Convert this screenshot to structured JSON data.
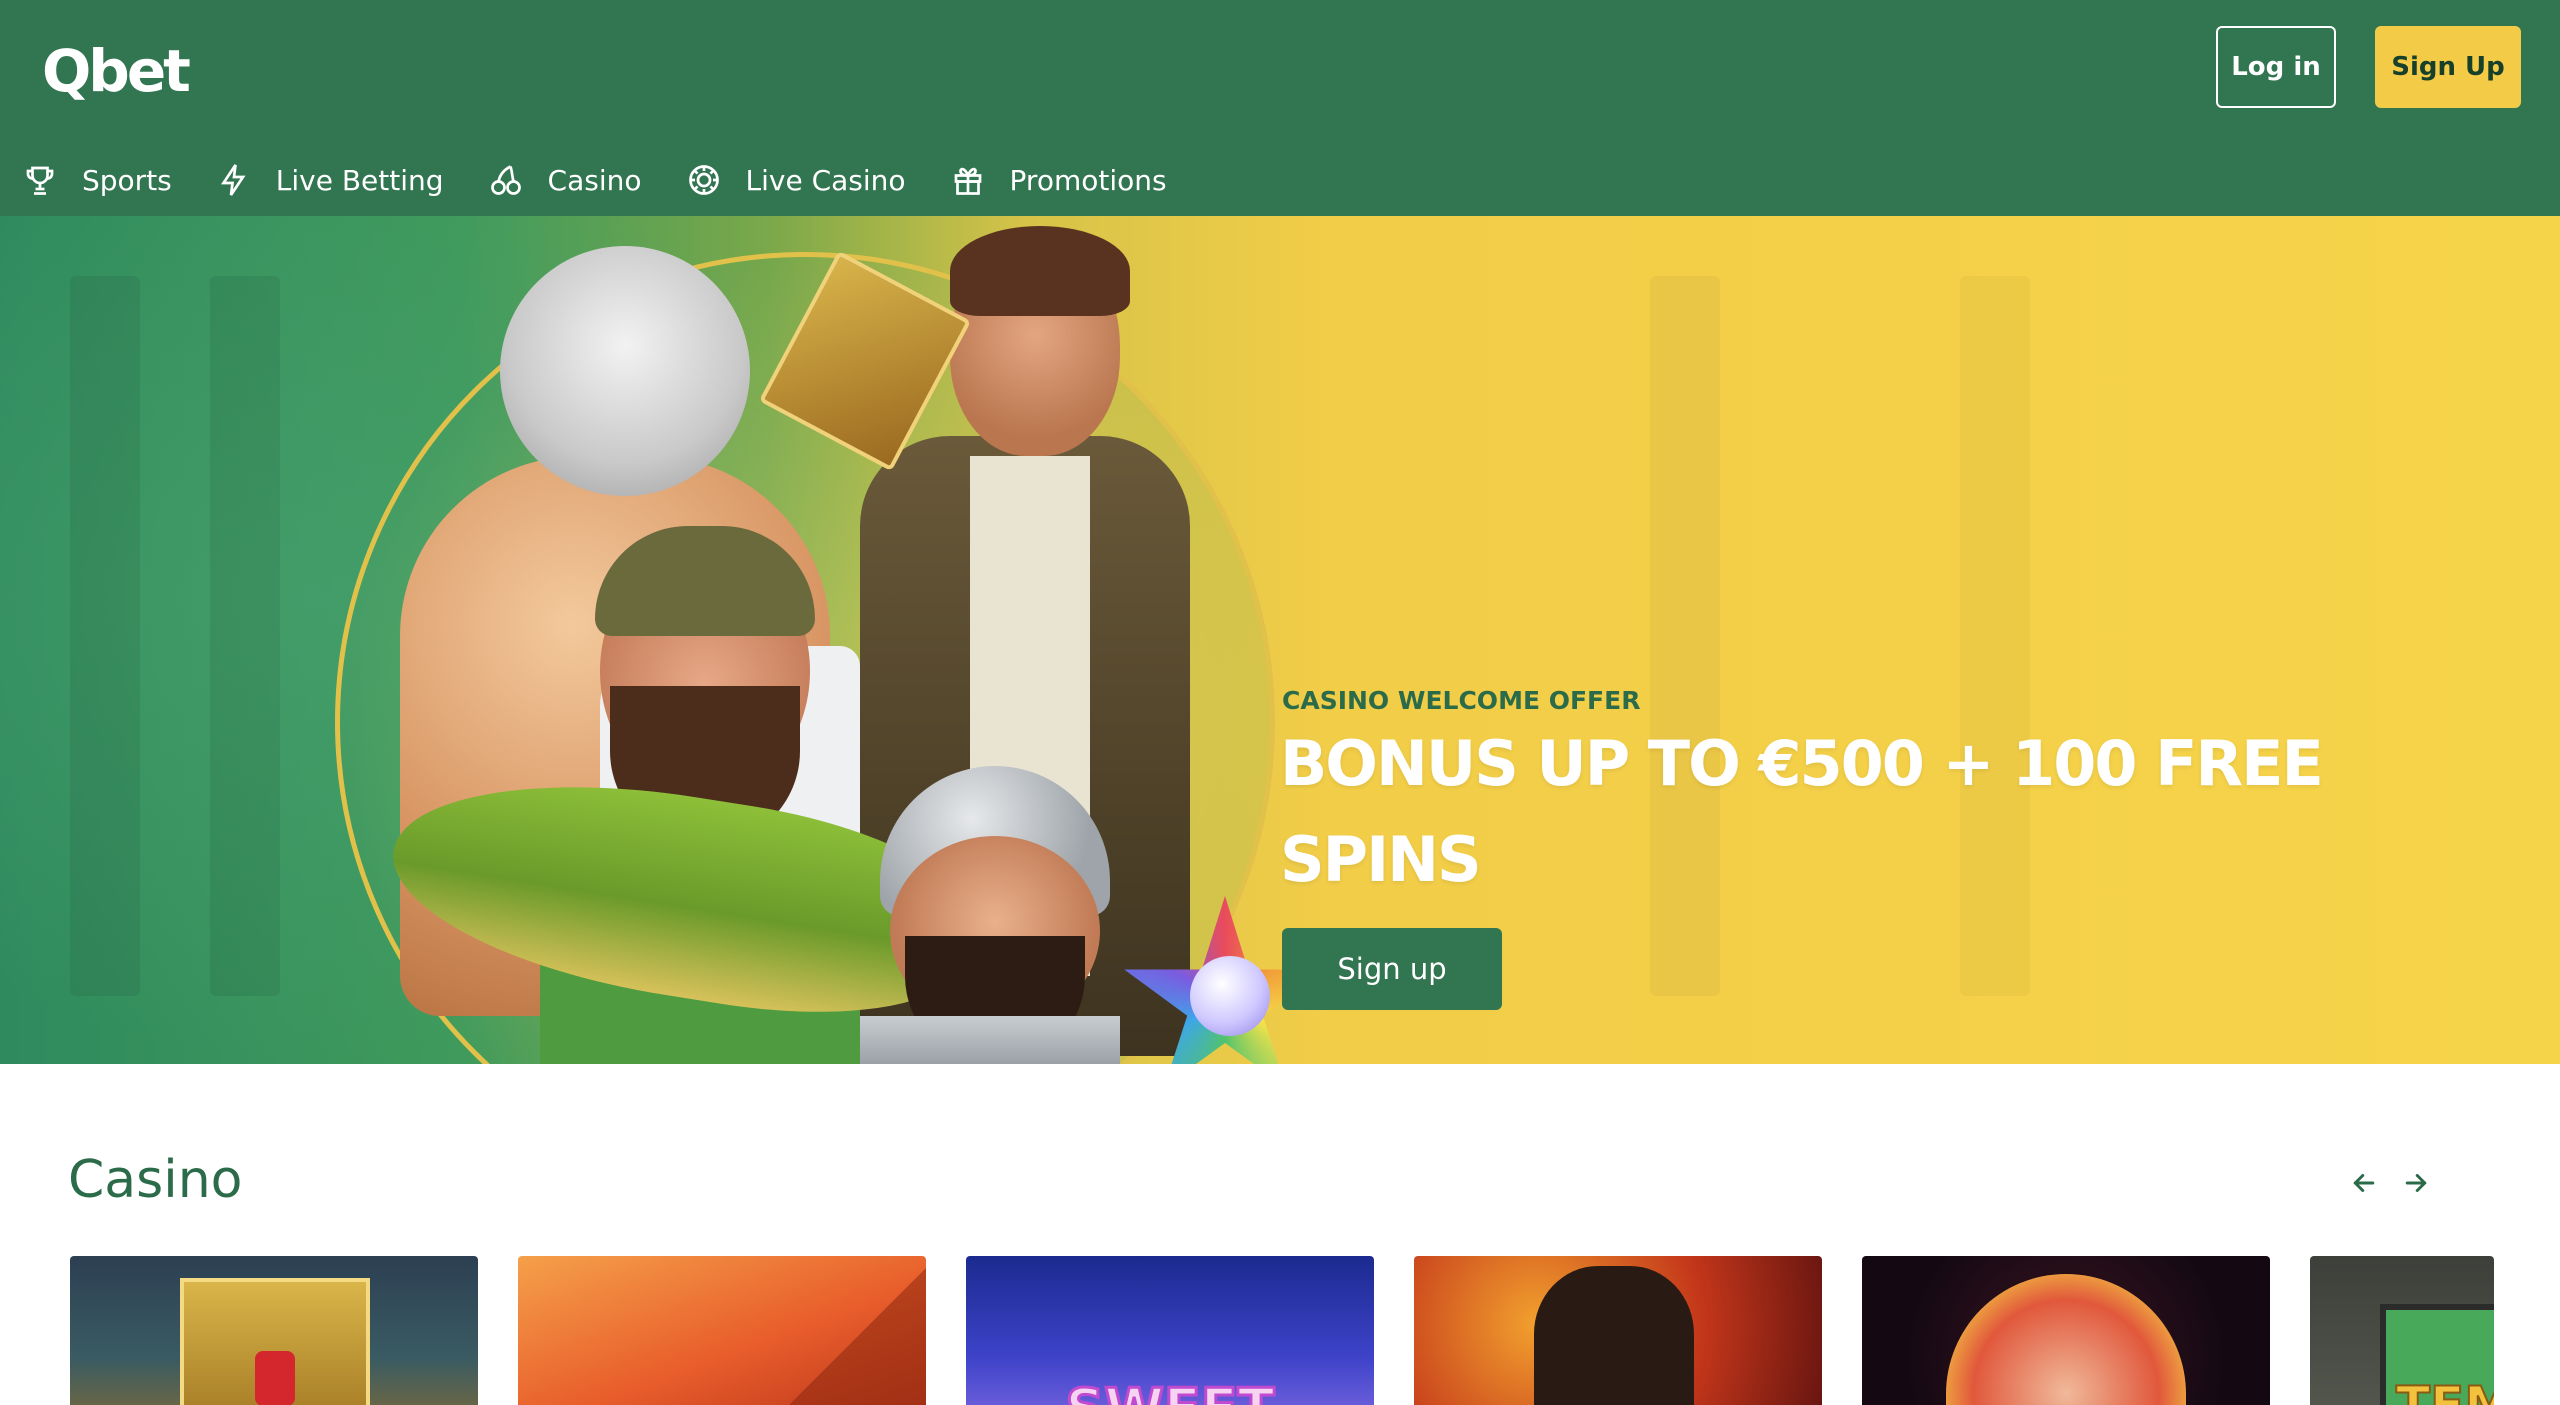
{
  "header": {
    "logo": "Qbet",
    "login_label": "Log in",
    "signup_label": "Sign Up"
  },
  "nav": {
    "items": [
      {
        "label": "Sports",
        "icon": "trophy-icon"
      },
      {
        "label": "Live Betting",
        "icon": "lightning-icon"
      },
      {
        "label": "Casino",
        "icon": "cherries-icon"
      },
      {
        "label": "Live Casino",
        "icon": "roulette-chip-icon"
      },
      {
        "label": "Promotions",
        "icon": "gift-icon"
      }
    ]
  },
  "hero": {
    "kicker": "CASINO WELCOME OFFER",
    "title": "BONUS UP TO €500 + 100 FREE SPINS",
    "button_label": "Sign up",
    "slides_total": 6,
    "active_slide": 2
  },
  "casino": {
    "title": "Casino",
    "prev_icon": "arrow-left-icon",
    "next_icon": "arrow-right-icon",
    "tiles": [
      {
        "label": ""
      },
      {
        "label": ""
      },
      {
        "label": "SWEET"
      },
      {
        "label": ""
      },
      {
        "label": ""
      },
      {
        "label": "TEM"
      }
    ]
  },
  "colors": {
    "brand_green": "#317551",
    "accent_yellow": "#f4cb47",
    "hero_yellow": "#f6d449",
    "heading_green": "#2b6b49"
  }
}
